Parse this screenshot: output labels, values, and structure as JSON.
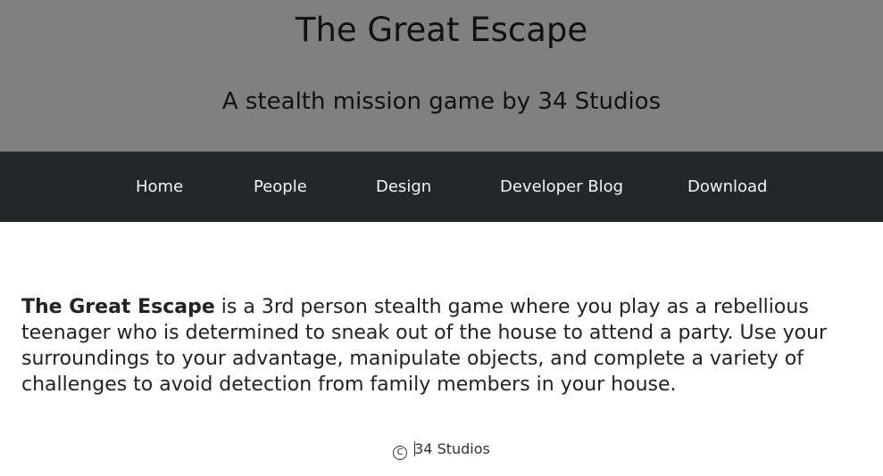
{
  "header": {
    "title": "The Great Escape",
    "subtitle": "A stealth mission game by 34 Studios"
  },
  "nav": {
    "items": [
      {
        "label": "Home"
      },
      {
        "label": "People"
      },
      {
        "label": "Design"
      },
      {
        "label": "Developer Blog"
      },
      {
        "label": "Download"
      }
    ]
  },
  "main": {
    "intro_bold": "The Great Escape",
    "intro_rest": " is a 3rd person stealth game where you play as a rebellious teenager who is determined to sneak out of the house to attend a party. Use your surroundings to your advantage, manipulate objects, and complete a variety of challenges to avoid detection from family members in your house."
  },
  "footer": {
    "copyright_symbol": "C",
    "text": "34 Studios"
  },
  "colors": {
    "header_bg": "#808080",
    "nav_bg": "#23272b",
    "nav_text": "#f4f4f4",
    "body_bg": "#ffffff"
  },
  "icons": {
    "copyright": "copyright-icon"
  }
}
